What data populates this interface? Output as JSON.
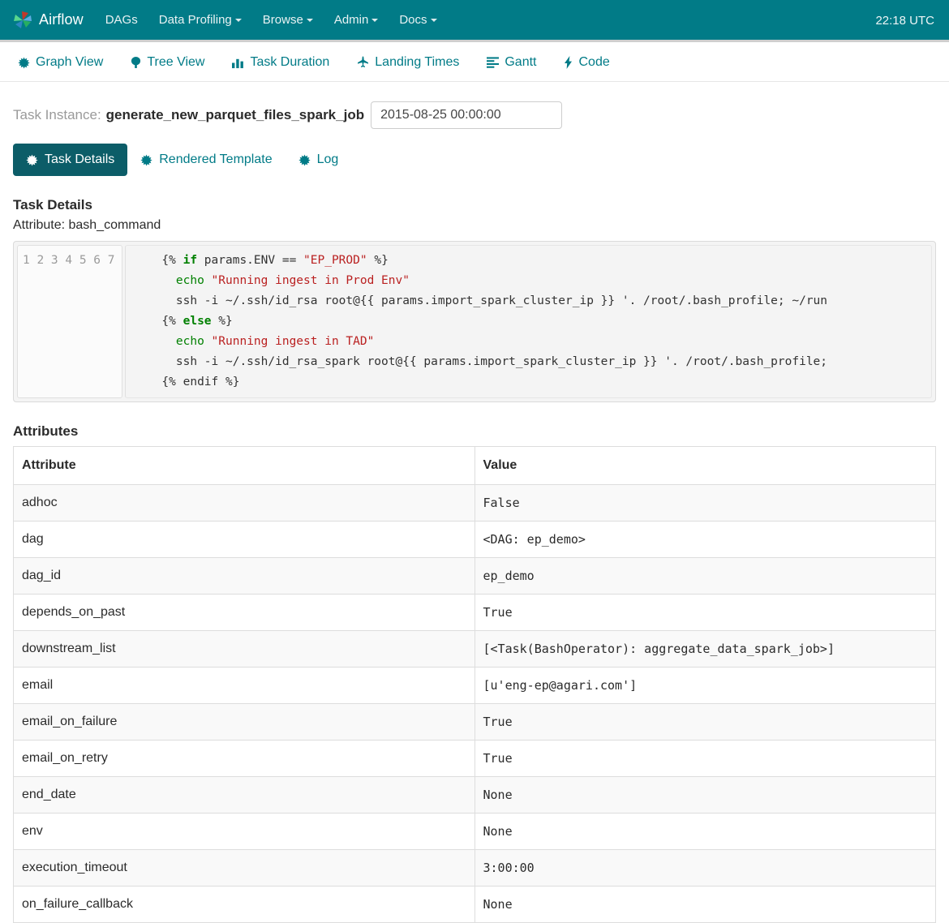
{
  "navbar": {
    "brand": "Airflow",
    "brand_icon": "airflow-pinwheel-logo",
    "items": [
      {
        "label": "DAGs",
        "caret": false
      },
      {
        "label": "Data Profiling",
        "caret": true
      },
      {
        "label": "Browse",
        "caret": true
      },
      {
        "label": "Admin",
        "caret": true
      },
      {
        "label": "Docs",
        "caret": true
      }
    ],
    "clock": "22:18 UTC",
    "background_color": "#017b87"
  },
  "subnav": {
    "items": [
      {
        "label": "Graph View",
        "icon": "asterisk-icon"
      },
      {
        "label": "Tree View",
        "icon": "tree-icon"
      },
      {
        "label": "Task Duration",
        "icon": "bar-chart-icon"
      },
      {
        "label": "Landing Times",
        "icon": "plane-icon"
      },
      {
        "label": "Gantt",
        "icon": "align-left-icon"
      },
      {
        "label": "Code",
        "icon": "bolt-icon"
      }
    ],
    "link_color": "#017b87"
  },
  "task_instance": {
    "label": "Task Instance:",
    "task_id": "generate_new_parquet_files_spark_job",
    "execution_date_value": "2015-08-25 00:00:00",
    "execution_date_placeholder": "2015-08-25 00:00:00"
  },
  "detail_tabs": {
    "active": "Task Details",
    "items": [
      {
        "label": "Task Details",
        "icon": "asterisk-icon",
        "active": true
      },
      {
        "label": "Rendered Template",
        "icon": "asterisk-icon",
        "active": false
      },
      {
        "label": "Log",
        "icon": "asterisk-icon",
        "active": false
      }
    ],
    "active_background_color": "#0c5d68"
  },
  "task_details": {
    "heading": "Task Details",
    "attribute_label": "Attribute: bash_command",
    "code": {
      "line_numbers": [
        "1",
        "2",
        "3",
        "4",
        "5",
        "6",
        "7"
      ],
      "lines": [
        [
          {
            "t": "    {% ",
            "c": "plain"
          },
          {
            "t": "if",
            "c": "kw"
          },
          {
            "t": " params.ENV == ",
            "c": "plain"
          },
          {
            "t": "\"EP_PROD\"",
            "c": "str"
          },
          {
            "t": " %}",
            "c": "plain"
          }
        ],
        [
          {
            "t": "      ",
            "c": "plain"
          },
          {
            "t": "echo",
            "c": "nm"
          },
          {
            "t": " ",
            "c": "plain"
          },
          {
            "t": "\"Running ingest in Prod Env\"",
            "c": "str"
          }
        ],
        [
          {
            "t": "      ssh -i ~/.ssh/id_rsa root@{{ params.import_spark_cluster_ip }} '. /root/.bash_profile; ~/run",
            "c": "plain"
          }
        ],
        [
          {
            "t": "    {% ",
            "c": "plain"
          },
          {
            "t": "else",
            "c": "kw"
          },
          {
            "t": " %}",
            "c": "plain"
          }
        ],
        [
          {
            "t": "      ",
            "c": "plain"
          },
          {
            "t": "echo",
            "c": "nm"
          },
          {
            "t": " ",
            "c": "plain"
          },
          {
            "t": "\"Running ingest in TAD\"",
            "c": "str"
          }
        ],
        [
          {
            "t": "      ssh -i ~/.ssh/id_rsa_spark root@{{ params.import_spark_cluster_ip }} '. /root/.bash_profile;",
            "c": "plain"
          }
        ],
        [
          {
            "t": "    {% endif %}",
            "c": "plain"
          }
        ]
      ]
    }
  },
  "attributes_section": {
    "heading": "Attributes",
    "columns": [
      "Attribute",
      "Value"
    ],
    "rows": [
      {
        "attribute": "adhoc",
        "value": "False"
      },
      {
        "attribute": "dag",
        "value": "<DAG: ep_demo>"
      },
      {
        "attribute": "dag_id",
        "value": "ep_demo"
      },
      {
        "attribute": "depends_on_past",
        "value": "True"
      },
      {
        "attribute": "downstream_list",
        "value": "[<Task(BashOperator): aggregate_data_spark_job>]"
      },
      {
        "attribute": "email",
        "value": "[u'eng-ep@agari.com']"
      },
      {
        "attribute": "email_on_failure",
        "value": "True"
      },
      {
        "attribute": "email_on_retry",
        "value": "True"
      },
      {
        "attribute": "end_date",
        "value": "None"
      },
      {
        "attribute": "env",
        "value": "None"
      },
      {
        "attribute": "execution_timeout",
        "value": "3:00:00"
      },
      {
        "attribute": "on_failure_callback",
        "value": "None"
      }
    ]
  }
}
